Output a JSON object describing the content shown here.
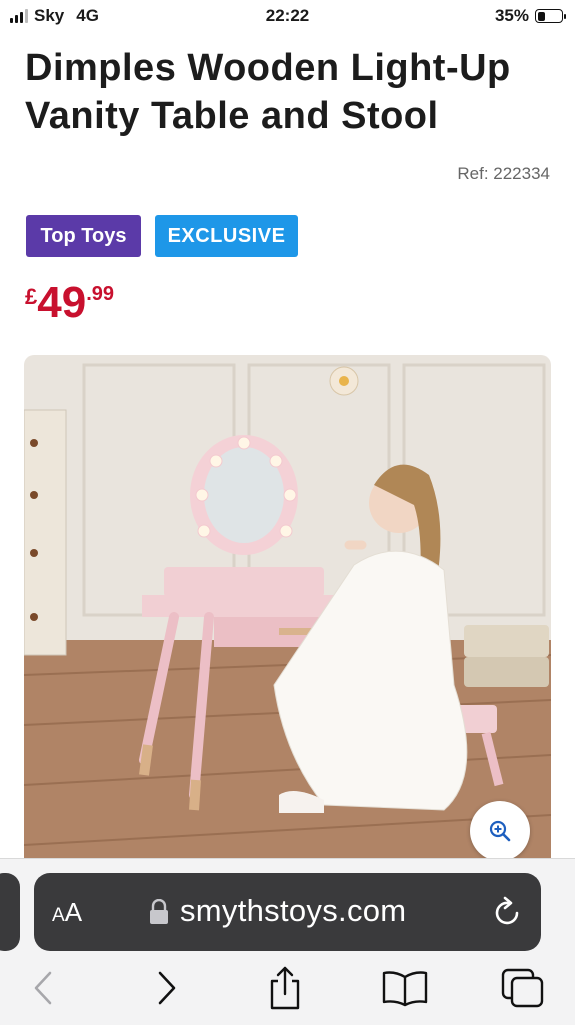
{
  "status_bar": {
    "carrier": "Sky",
    "network": "4G",
    "time": "22:22",
    "battery_percent": "35%",
    "battery_level": 0.35
  },
  "product": {
    "title": "Dimples Wooden Light-Up Vanity Table and Stool",
    "ref": "Ref: 222334",
    "badges": [
      "Top Toys",
      "EXCLUSIVE"
    ],
    "price": {
      "currency": "£",
      "whole": "49",
      "decimal": ".99"
    },
    "image_alt": "Girl sitting at pink wooden light-up vanity table with stool"
  },
  "safari": {
    "text_size_label": "AA",
    "url": "smythstoys.com"
  },
  "colors": {
    "price": "#c8102e",
    "badge_top_toys": "#5b3aa8",
    "badge_exclusive": "#1e97e8",
    "address_bar": "#3a3a3c"
  },
  "icons": [
    "signal-icon",
    "battery-icon",
    "zoom-in-icon",
    "lock-icon",
    "reload-icon",
    "back-icon",
    "forward-icon",
    "share-icon",
    "bookmarks-icon",
    "tabs-icon"
  ]
}
